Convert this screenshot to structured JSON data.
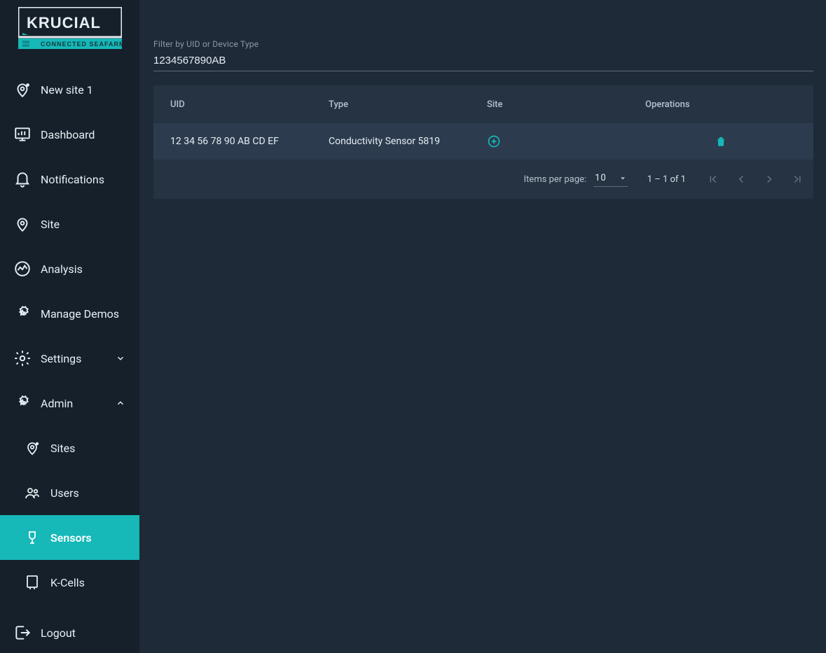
{
  "brand": {
    "name": "KRUCIAL",
    "tagline": "CONNECTED SEAFARM"
  },
  "sidebar": {
    "items": [
      {
        "id": "new-site-1",
        "label": "New site 1",
        "icon": "map-pin-dot-icon"
      },
      {
        "id": "dashboard",
        "label": "Dashboard",
        "icon": "dashboard-icon"
      },
      {
        "id": "notifications",
        "label": "Notifications",
        "icon": "bell-icon"
      },
      {
        "id": "site",
        "label": "Site",
        "icon": "map-pin-icon"
      },
      {
        "id": "analysis",
        "label": "Analysis",
        "icon": "analytics-icon"
      },
      {
        "id": "manage-demos",
        "label": "Manage Demos",
        "icon": "star-badge-icon"
      },
      {
        "id": "settings",
        "label": "Settings",
        "icon": "gear-icon",
        "expandable": true,
        "expanded": false
      },
      {
        "id": "admin",
        "label": "Admin",
        "icon": "star-badge-icon",
        "expandable": true,
        "expanded": true
      }
    ],
    "adminSub": [
      {
        "id": "sites",
        "label": "Sites",
        "icon": "map-pin-dot-icon"
      },
      {
        "id": "users",
        "label": "Users",
        "icon": "users-icon"
      },
      {
        "id": "sensors",
        "label": "Sensors",
        "icon": "sensor-icon",
        "active": true
      },
      {
        "id": "kcells",
        "label": "K-Cells",
        "icon": "kcell-icon"
      }
    ],
    "logout": {
      "label": "Logout",
      "icon": "logout-icon"
    }
  },
  "filter": {
    "label": "Filter by UID or Device Type",
    "value": "1234567890AB"
  },
  "table": {
    "columns": [
      "UID",
      "Type",
      "Site",
      "Operations"
    ],
    "rows": [
      {
        "uid": "12 34 56 78 90 AB CD EF",
        "type": "Conductivity Sensor 5819"
      }
    ],
    "footer": {
      "itemsPerPageLabel": "Items per page:",
      "itemsPerPageValue": "10",
      "range": "1 – 1 of 1"
    }
  }
}
